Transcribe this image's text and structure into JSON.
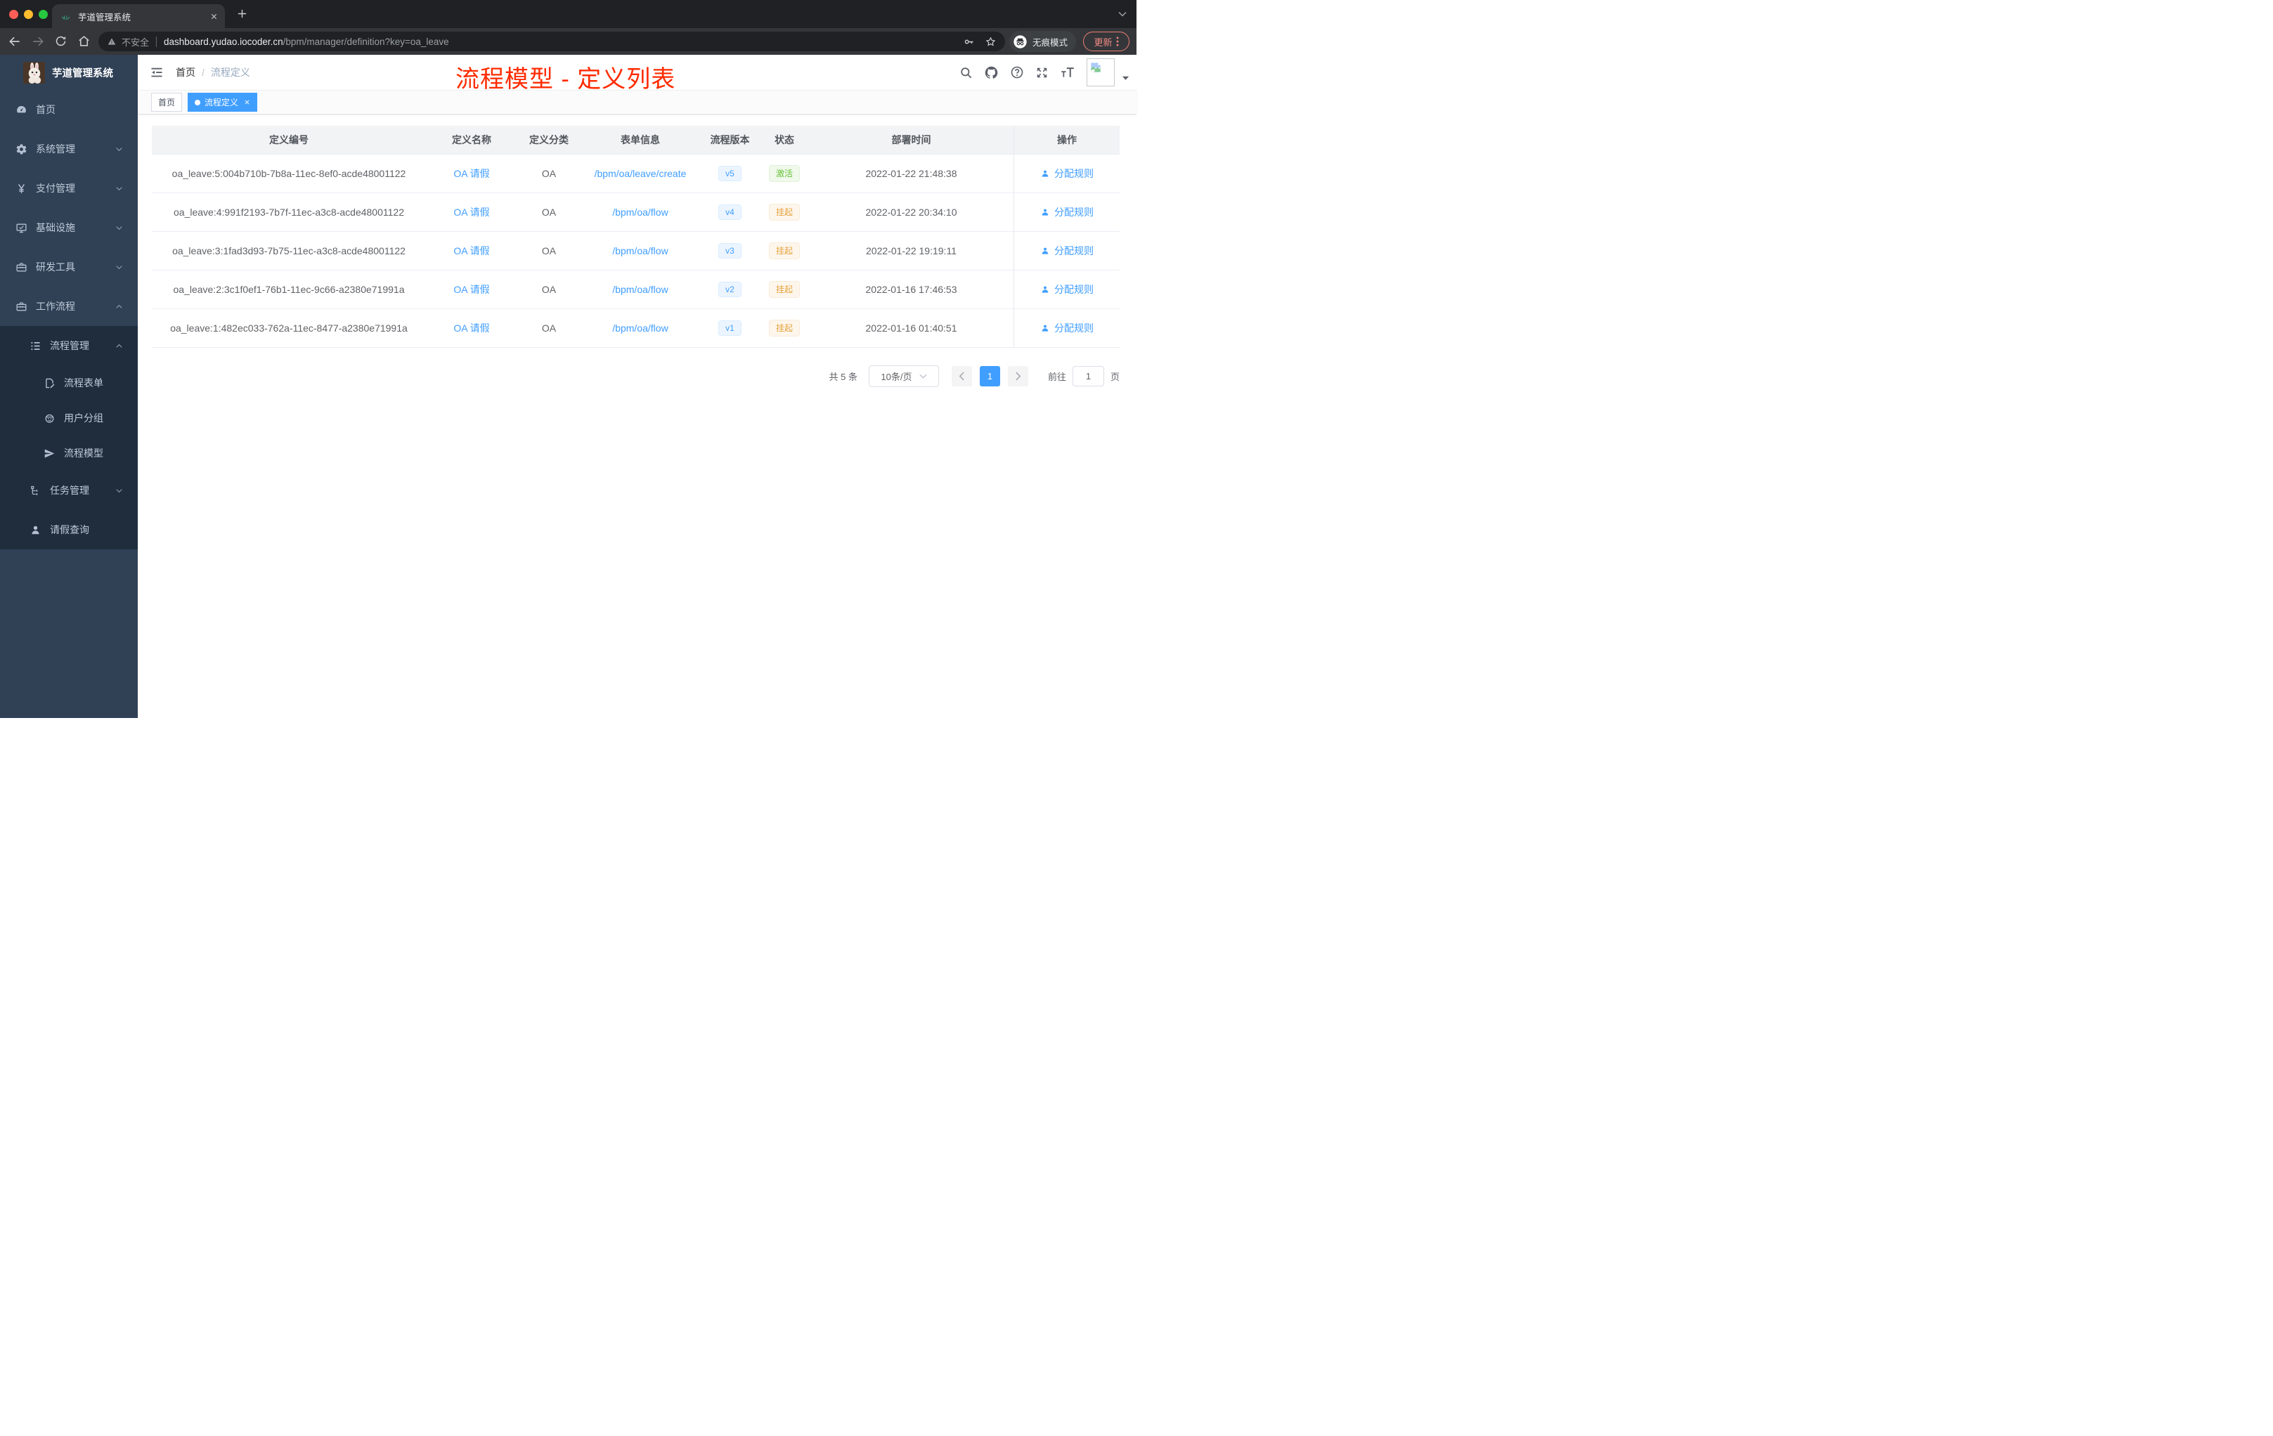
{
  "browser": {
    "tab": {
      "title": "芋道管理系统"
    },
    "address": {
      "security_label": "不安全",
      "url_domain": "dashboard.yudao.iocoder.cn",
      "url_path": "/bpm/manager/definition?key=oa_leave"
    },
    "incognito_label": "无痕模式",
    "update_label": "更新"
  },
  "sidebar": {
    "logo_title": "芋道管理系统",
    "menu": [
      {
        "key": "home",
        "icon": "dashboard-icon",
        "label": "首页",
        "level": 1
      },
      {
        "key": "system-mgmt",
        "icon": "gear-icon",
        "label": "系统管理",
        "level": 1,
        "chevron": "down"
      },
      {
        "key": "payment-mgmt",
        "icon": "yen-icon",
        "label": "支付管理",
        "level": 1,
        "chevron": "down"
      },
      {
        "key": "infrastructure",
        "icon": "monitor-icon",
        "label": "基础设施",
        "level": 1,
        "chevron": "down"
      },
      {
        "key": "dev-tools",
        "icon": "toolbox-icon",
        "label": "研发工具",
        "level": 1,
        "chevron": "down"
      },
      {
        "key": "workflow",
        "icon": "suitcase-icon",
        "label": "工作流程",
        "level": 1,
        "chevron": "up"
      }
    ],
    "submenu": [
      {
        "key": "process-mgmt",
        "icon": "list-tree-icon",
        "label": "流程管理",
        "level": 2,
        "chevron": "up"
      },
      {
        "key": "process-form",
        "icon": "form-edit-icon",
        "label": "流程表单",
        "level": 3
      },
      {
        "key": "user-group",
        "icon": "user-group-icon",
        "label": "用户分组",
        "level": 3
      },
      {
        "key": "process-model",
        "icon": "paper-plane-icon",
        "label": "流程模型",
        "level": 3
      },
      {
        "key": "task-mgmt",
        "icon": "task-tree-icon",
        "label": "任务管理",
        "level": 2,
        "chevron": "down"
      },
      {
        "key": "leave-query",
        "icon": "person-icon",
        "label": "请假查询",
        "level": 2
      }
    ]
  },
  "navbar": {
    "breadcrumb": {
      "home": "首页",
      "separator": "/",
      "current": "流程定义"
    }
  },
  "annotation": {
    "text": "流程模型 - 定义列表",
    "color": "#ff2b00"
  },
  "tags": [
    {
      "label": "首页",
      "active": false
    },
    {
      "label": "流程定义",
      "active": true
    }
  ],
  "table": {
    "columns": [
      "定义编号",
      "定义名称",
      "定义分类",
      "表单信息",
      "流程版本",
      "状态",
      "部署时间",
      "操作"
    ],
    "rows": [
      {
        "id": "oa_leave:5:004b710b-7b8a-11ec-8ef0-acde48001122",
        "name": "OA 请假",
        "category": "OA",
        "form": "/bpm/oa/leave/create",
        "version": "v5",
        "status": "激活",
        "status_type": "success",
        "deploy_time": "2022-01-22 21:48:38",
        "action": "分配规则"
      },
      {
        "id": "oa_leave:4:991f2193-7b7f-11ec-a3c8-acde48001122",
        "name": "OA 请假",
        "category": "OA",
        "form": "/bpm/oa/flow",
        "version": "v4",
        "status": "挂起",
        "status_type": "warning",
        "deploy_time": "2022-01-22 20:34:10",
        "action": "分配规则"
      },
      {
        "id": "oa_leave:3:1fad3d93-7b75-11ec-a3c8-acde48001122",
        "name": "OA 请假",
        "category": "OA",
        "form": "/bpm/oa/flow",
        "version": "v3",
        "status": "挂起",
        "status_type": "warning",
        "deploy_time": "2022-01-22 19:19:11",
        "action": "分配规则"
      },
      {
        "id": "oa_leave:2:3c1f0ef1-76b1-11ec-9c66-a2380e71991a",
        "name": "OA 请假",
        "category": "OA",
        "form": "/bpm/oa/flow",
        "version": "v2",
        "status": "挂起",
        "status_type": "warning",
        "deploy_time": "2022-01-16 17:46:53",
        "action": "分配规则"
      },
      {
        "id": "oa_leave:1:482ec033-762a-11ec-8477-a2380e71991a",
        "name": "OA 请假",
        "category": "OA",
        "form": "/bpm/oa/flow",
        "version": "v1",
        "status": "挂起",
        "status_type": "warning",
        "deploy_time": "2022-01-16 01:40:51",
        "action": "分配规则"
      }
    ]
  },
  "pagination": {
    "total": "共 5 条",
    "page_size": "10条/页",
    "current_page": "1",
    "goto_label": "前往",
    "goto_value": "1",
    "page_unit": "页"
  },
  "colors": {
    "primary": "#409eff",
    "success": "#67c23a",
    "warning": "#e6a23c",
    "sidebar_bg": "#304156",
    "submenu_bg": "#1f2d3d",
    "annotation_red": "#ff2b00"
  }
}
